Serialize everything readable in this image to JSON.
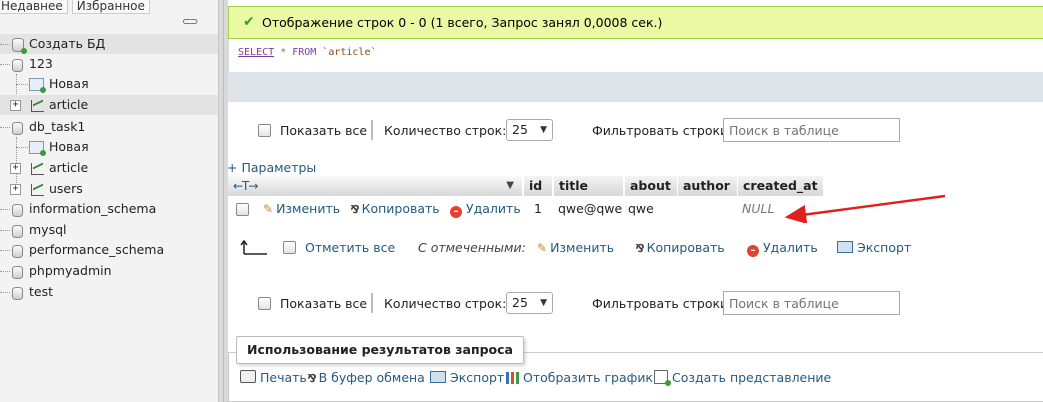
{
  "nav": {
    "tabs": [
      "Недавнее",
      "Избранное"
    ],
    "link_icon": "chain-link-icon",
    "create_db": "Создать БД",
    "items": [
      {
        "label": "123",
        "level": 0
      },
      {
        "label": "Новая",
        "level": 1,
        "kind": "new"
      },
      {
        "label": "article",
        "level": 1,
        "kind": "table",
        "selected": true
      },
      {
        "label": "db_task1",
        "level": 0
      },
      {
        "label": "Новая",
        "level": 1,
        "kind": "new"
      },
      {
        "label": "article",
        "level": 1,
        "kind": "table"
      },
      {
        "label": "users",
        "level": 1,
        "kind": "table"
      },
      {
        "label": "information_schema",
        "level": 0
      },
      {
        "label": "mysql",
        "level": 0
      },
      {
        "label": "performance_schema",
        "level": 0
      },
      {
        "label": "phpmyadmin",
        "level": 0
      },
      {
        "label": "test",
        "level": 0
      }
    ]
  },
  "main": {
    "success_message": "Отображение строк 0 - 0 (1 всего, Запрос занял 0,0008 сек.)",
    "sql": {
      "kw": "SELECT",
      "rest1": " * ",
      "kw2": "FROM",
      "table": " `article`"
    },
    "navbar": {
      "show_all": "Показать все",
      "rows_label": "Количество строк:",
      "rows_value": "25",
      "filter_label": "Фильтровать строки:",
      "filter_placeholder": "Поиск в таблице"
    },
    "params_link": "+ Параметры",
    "table": {
      "resize_arrows": "←T→",
      "columns": [
        "id",
        "title",
        "about",
        "author",
        "created_at"
      ],
      "row": {
        "edit": "Изменить",
        "copy": "Копировать",
        "delete": "Удалить",
        "id": "1",
        "title": "qwe@qwe",
        "about": "qwe",
        "author": "",
        "created_at": "NULL"
      }
    },
    "with_selected": {
      "check_all": "Отметить все",
      "label": "С отмеченными:",
      "edit": "Изменить",
      "copy": "Копировать",
      "delete": "Удалить",
      "export": "Экспорт"
    },
    "query_results": {
      "legend": "Использование результатов запроса",
      "print": "Печать",
      "clipboard": "В буфер обмена",
      "export": "Экспорт",
      "chart": "Отобразить график",
      "create_view": "Создать представление"
    },
    "annotation_arrow_color": "#e0201a"
  }
}
